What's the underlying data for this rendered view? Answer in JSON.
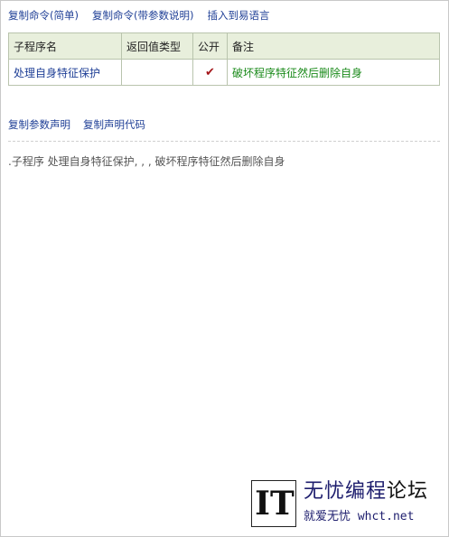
{
  "top_actions": {
    "copy_command_simple": "复制命令(简单)",
    "copy_command_with_params": "复制命令(带参数说明)",
    "insert_to_easy_language": "插入到易语言"
  },
  "table": {
    "headers": {
      "name": "子程序名",
      "return_type": "返回值类型",
      "public": "公开",
      "remark": "备注"
    },
    "rows": [
      {
        "name": "处理自身特征保护",
        "return_type": "",
        "public": "✔",
        "remark": "破坏程序特征然后删除自身"
      }
    ]
  },
  "mid_actions": {
    "copy_param_decl": "复制参数声明",
    "copy_decl_code": "复制声明代码"
  },
  "declaration_text": ".子程序 处理自身特征保护, , , 破坏程序特征然后删除自身",
  "watermark": {
    "logo": "IT",
    "title_main": "无忧编程",
    "title_accent": "论坛",
    "subtitle": "就爱无忧 whct.net"
  },
  "colors": {
    "link": "#1f3f96",
    "header_bg": "#e8efdc",
    "remark_green": "#1a8a1a",
    "check_red": "#a4161a"
  }
}
